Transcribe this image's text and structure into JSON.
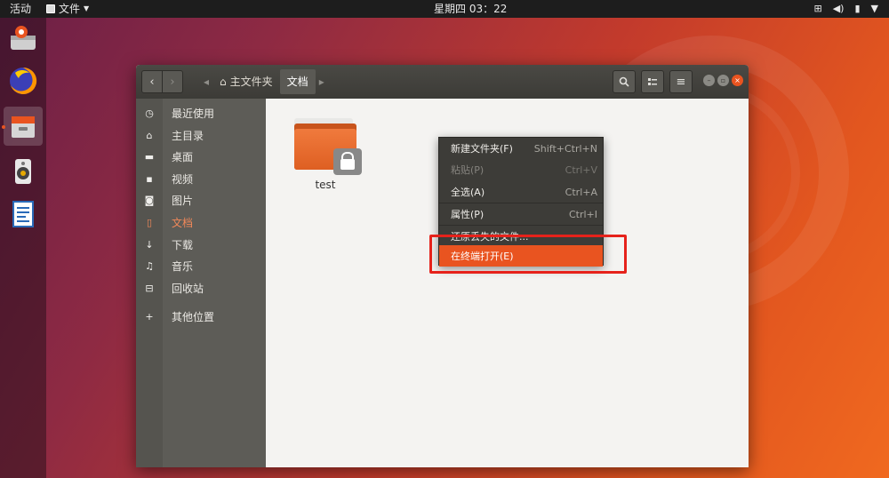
{
  "topbar": {
    "activities": "活动",
    "app_menu": "文件",
    "clock": "星期四 03：22"
  },
  "dock": {
    "items": [
      "installer-icon",
      "firefox-icon",
      "files-icon",
      "rhythmbox-icon",
      "writer-icon"
    ]
  },
  "window": {
    "breadcrumbs": [
      "主文件夹",
      "文档"
    ],
    "sidebar": {
      "items": [
        {
          "label": "最近使用",
          "icon": "clock-icon"
        },
        {
          "label": "主目录",
          "icon": "home-icon"
        },
        {
          "label": "桌面",
          "icon": "folder-icon"
        },
        {
          "label": "视频",
          "icon": "video-icon"
        },
        {
          "label": "图片",
          "icon": "camera-icon"
        },
        {
          "label": "文档",
          "icon": "document-icon"
        },
        {
          "label": "下载",
          "icon": "download-icon"
        },
        {
          "label": "音乐",
          "icon": "music-icon"
        },
        {
          "label": "回收站",
          "icon": "trash-icon"
        },
        {
          "label": "其他位置",
          "icon": "plus-icon"
        }
      ],
      "selected": "文档"
    },
    "files": [
      {
        "name": "test",
        "icon": "locked-folder-icon"
      }
    ]
  },
  "context_menu": {
    "items": [
      {
        "label": "新建文件夹(F)",
        "accel": "Shift+Ctrl+N",
        "enabled": true
      },
      {
        "label": "粘贴(P)",
        "accel": "Ctrl+V",
        "enabled": false
      },
      {
        "label": "全选(A)",
        "accel": "Ctrl+A",
        "enabled": true
      },
      {
        "label": "属性(P)",
        "accel": "Ctrl+I",
        "enabled": true
      },
      {
        "label": "还原丢失的文件...",
        "accel": "",
        "enabled": true
      },
      {
        "label": "在终端打开(E)",
        "accel": "",
        "enabled": true,
        "highlighted": true
      }
    ]
  },
  "colors": {
    "accent": "#e95420",
    "annotation": "#e6221b"
  }
}
